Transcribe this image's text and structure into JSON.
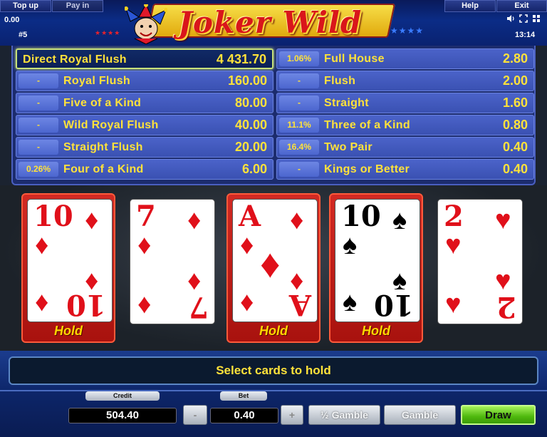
{
  "header": {
    "top_up": "Top up",
    "pay_in": "Pay in",
    "help": "Help",
    "exit": "Exit",
    "balance": "0.00",
    "game_number": "#5",
    "clock": "13:14",
    "logo_text": "Joker Wild",
    "icons": [
      "sound-icon",
      "fullscreen-icon",
      "settings-icon"
    ]
  },
  "paytable": {
    "left": [
      {
        "percent": "",
        "name": "Direct Royal Flush",
        "value": "4 431.70",
        "highlight": true
      },
      {
        "percent": "-",
        "name": "Royal Flush",
        "value": "160.00"
      },
      {
        "percent": "-",
        "name": "Five of a Kind",
        "value": "80.00"
      },
      {
        "percent": "-",
        "name": "Wild Royal Flush",
        "value": "40.00"
      },
      {
        "percent": "-",
        "name": "Straight Flush",
        "value": "20.00"
      },
      {
        "percent": "0.26%",
        "name": "Four of a Kind",
        "value": "6.00"
      }
    ],
    "right": [
      {
        "percent": "1.06%",
        "name": "Full House",
        "value": "2.80"
      },
      {
        "percent": "-",
        "name": "Flush",
        "value": "2.00"
      },
      {
        "percent": "-",
        "name": "Straight",
        "value": "1.60"
      },
      {
        "percent": "11.1%",
        "name": "Three of a Kind",
        "value": "0.80"
      },
      {
        "percent": "16.4%",
        "name": "Two Pair",
        "value": "0.40"
      },
      {
        "percent": "-",
        "name": "Kings or Better",
        "value": "0.40"
      }
    ]
  },
  "cards": [
    {
      "rank": "10",
      "suit": "♦",
      "color": "red",
      "held": true,
      "hold_label": "Hold"
    },
    {
      "rank": "7",
      "suit": "♦",
      "color": "red",
      "held": false,
      "hold_label": ""
    },
    {
      "rank": "A",
      "suit": "♦",
      "color": "red",
      "held": true,
      "hold_label": "Hold"
    },
    {
      "rank": "10",
      "suit": "♠",
      "color": "black",
      "held": true,
      "hold_label": "Hold"
    },
    {
      "rank": "2",
      "suit": "♥",
      "color": "red",
      "held": false,
      "hold_label": ""
    }
  ],
  "controls": {
    "message": "Select cards to hold",
    "credit_label": "Credit",
    "credit_value": "504.40",
    "bet_label": "Bet",
    "bet_value": "0.40",
    "minus": "-",
    "plus": "+",
    "half_gamble": "½ Gamble",
    "gamble": "Gamble",
    "draw": "Draw"
  },
  "colors": {
    "accent_yellow": "#ffe23a",
    "hold_red": "#d22a23",
    "draw_green": "#4fb80e",
    "paytable_blue": "#3a51b2"
  }
}
